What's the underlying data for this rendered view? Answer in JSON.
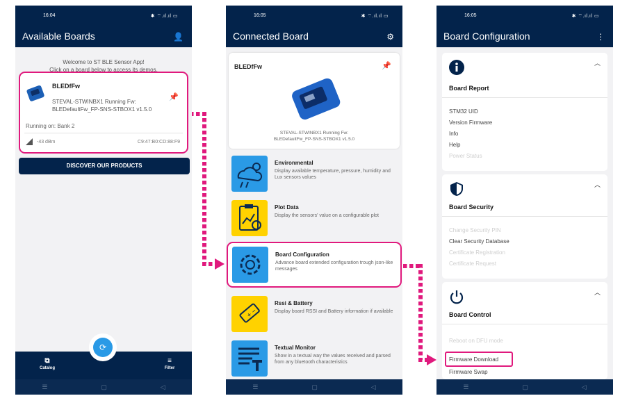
{
  "screen1": {
    "time": "16:04",
    "status_icons": "✱ ⌔.ıl.ıl ▭",
    "title": "Available Boards",
    "welcome_line1": "Welcome to ST BLE Sensor App!",
    "welcome_line2": "Click on a board below to access its demos.",
    "board": {
      "name": "BLEDfFw",
      "desc_line1": "STEVAL-STWINBX1 Running Fw:",
      "desc_line2": "BLEDefaultFw_FP-SNS-STBOX1 v1.5.0",
      "running_on": "Running on: Bank 2",
      "rssi": "-43 dBm",
      "mac": "C9:47:B0:CD:88:F9"
    },
    "discover_label": "DISCOVER OUR PRODUCTS",
    "catalog_label": "Catalog",
    "filter_label": "Filter"
  },
  "screen2": {
    "time": "16:05",
    "status_icons": "✱ ⌔.ıl.ıl ▭",
    "title": "Connected Board",
    "board": {
      "name": "BLEDfFw",
      "desc_line1": "STEVAL-STWINBX1 Running Fw:",
      "desc_line2": "BLEDefaultFw_FP-SNS-STBOX1 v1.5.0"
    },
    "demos": [
      {
        "title": "Environmental",
        "desc": "Display available temperature, pressure, humidity and Lux sensors values"
      },
      {
        "title": "Plot Data",
        "desc": "Display the sensors' value on a configurable plot"
      },
      {
        "title": "Board Configuration",
        "desc": "Advance board extended configuration trough json-like messages"
      },
      {
        "title": "Rssi & Battery",
        "desc": "Display board RSSI and Battery information if available"
      },
      {
        "title": "Textual Monitor",
        "desc": "Show in a textual way the values received and parsed from any bluetooth characteristics"
      }
    ]
  },
  "screen3": {
    "time": "16:05",
    "status_icons": "✱ ⌔.ıl.ıl ▭",
    "title": "Board Configuration",
    "report": {
      "heading": "Board Report",
      "items": [
        "STM32 UID",
        "Version Firmware",
        "Info",
        "Help",
        "Power Status"
      ]
    },
    "security": {
      "heading": "Board Security",
      "items": [
        "Change Security PIN",
        "Clear Security Database",
        "Certificate Registration",
        "Certificate Request"
      ]
    },
    "control": {
      "heading": "Board Control",
      "items": [
        "Reboot on DFU mode",
        "Firmware Download",
        "Firmware Swap"
      ]
    }
  },
  "colors": {
    "primary": "#03234b",
    "highlight": "#e0197d",
    "accent_blue": "#2a9ae6",
    "pin_yellow": "#f5c400"
  }
}
